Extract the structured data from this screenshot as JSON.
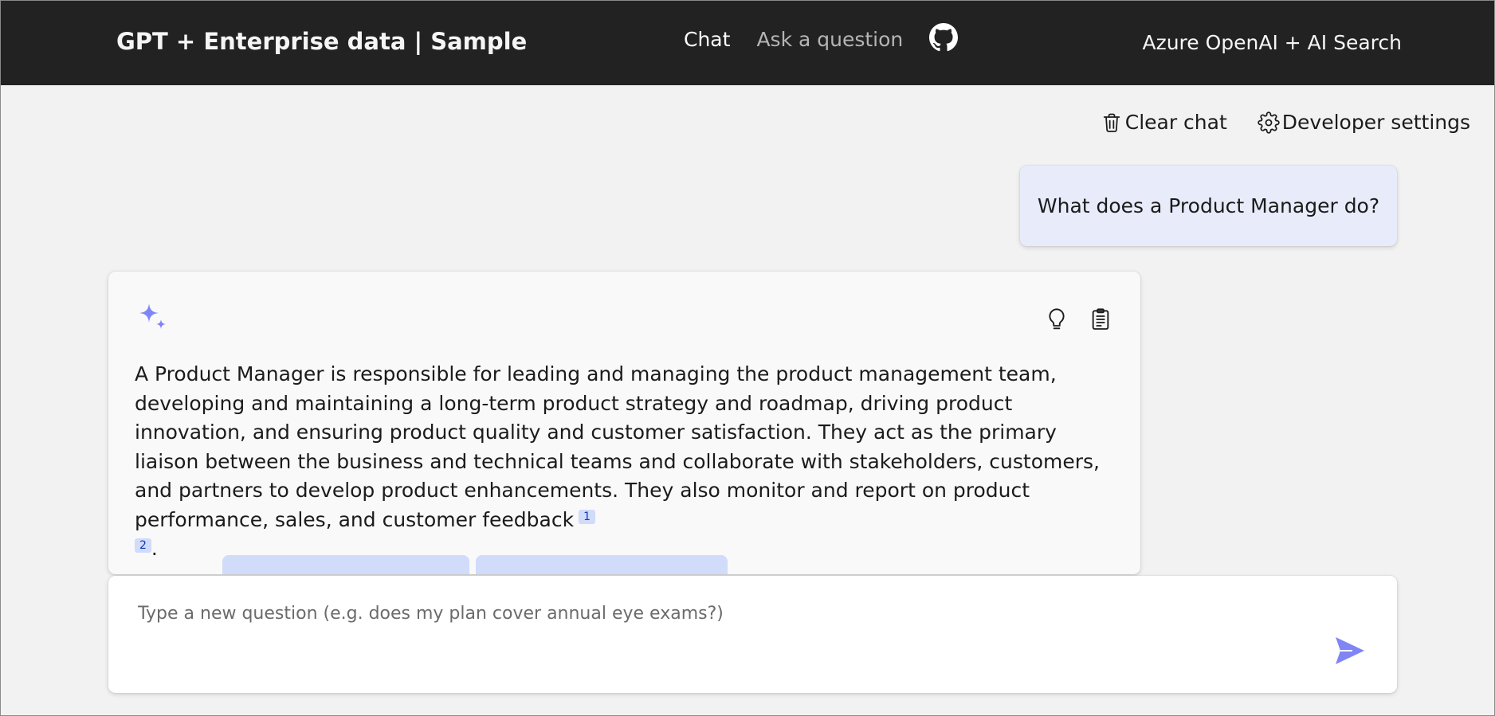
{
  "header": {
    "title": "GPT + Enterprise data | Sample",
    "nav": [
      {
        "label": "Chat",
        "active": true
      },
      {
        "label": "Ask a question",
        "active": false
      }
    ],
    "github_icon": "github-icon",
    "right_text": "Azure OpenAI + AI Search"
  },
  "commands": {
    "clear_chat": "Clear chat",
    "clear_chat_icon": "trash-icon",
    "developer_settings": "Developer settings",
    "developer_settings_icon": "gear-icon"
  },
  "conversation": {
    "user_message": "What does a Product Manager do?",
    "answer": {
      "icon": "sparkle-icon",
      "text": "A Product Manager is responsible for leading and managing the product management team, developing and maintaining a long-term product strategy and roadmap, driving product innovation, and ensuring product quality and customer satisfaction. They act as the primary liaison between the business and technical teams and collaborate with stakeholders, customers, and partners to develop product enhancements. They also monitor and report on product performance, sales, and customer feedback",
      "citations": [
        "1",
        "2"
      ],
      "trailing": ".",
      "actions": [
        "lightbulb-icon",
        "clipboard-icon"
      ]
    }
  },
  "composer": {
    "placeholder": "Type a new question (e.g. does my plan cover annual eye exams?)",
    "value": "",
    "send_icon": "send-icon"
  },
  "colors": {
    "header_bg": "#222222",
    "page_bg": "#f2f2f2",
    "user_bubble_bg": "#e8ebfa",
    "accent": "#7f85f5",
    "citation_bg": "#d1dbfa",
    "citation_text": "#123bb6"
  }
}
